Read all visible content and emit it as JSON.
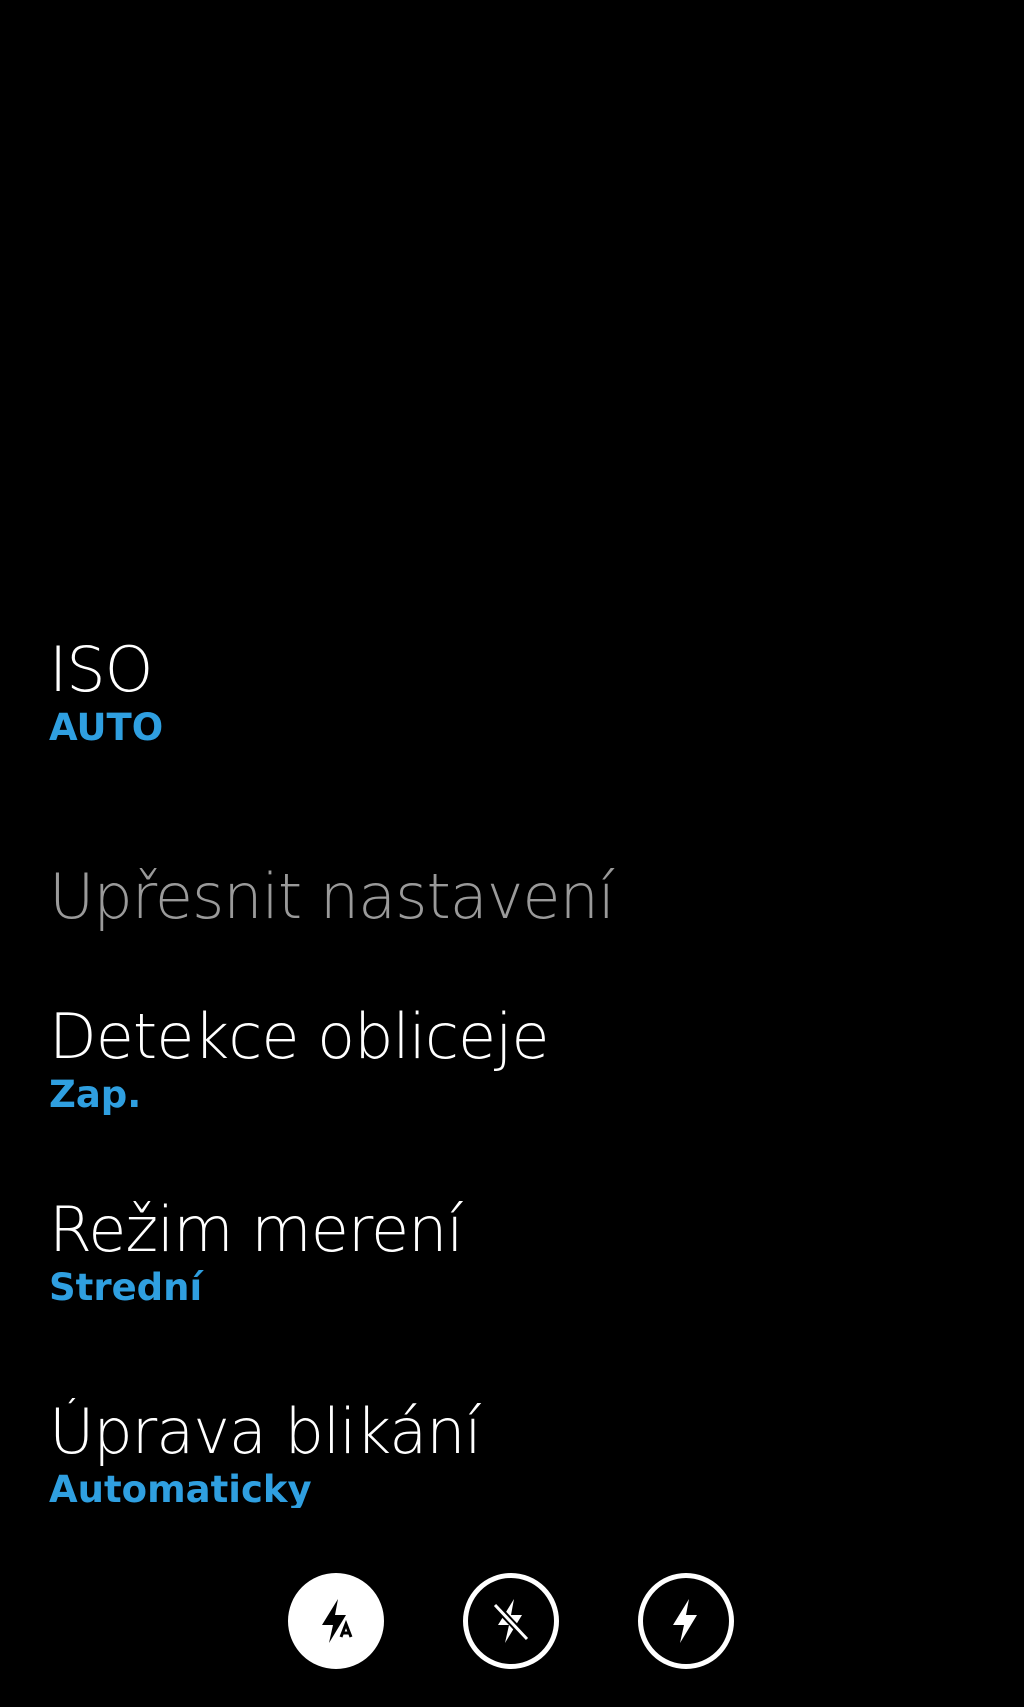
{
  "settings": [
    {
      "title": "ISO",
      "value": "AUTO"
    }
  ],
  "advanced": {
    "header": "Upřesnit nastavení",
    "items": [
      {
        "title": "Detekce obliceje",
        "value": "Zap."
      },
      {
        "title": "Režim merení",
        "value": "Strední"
      },
      {
        "title": "Úprava blikání",
        "value": "Automaticky"
      }
    ]
  },
  "flash_modes": [
    {
      "icon": "flash-auto-icon",
      "selected": true
    },
    {
      "icon": "flash-off-icon",
      "selected": false
    },
    {
      "icon": "flash-on-icon",
      "selected": false
    }
  ],
  "colors": {
    "background": "#000000",
    "accent": "#2f9fe0",
    "header": "#9a9a9a"
  }
}
